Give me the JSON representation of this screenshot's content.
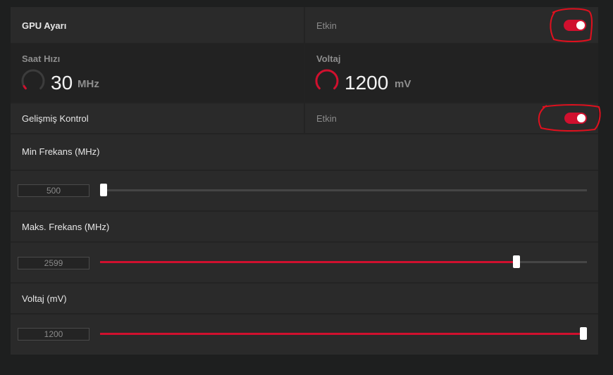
{
  "gpu_settings": {
    "title": "GPU Ayarı",
    "status": "Etkin",
    "enabled": true
  },
  "stats": {
    "clock": {
      "title": "Saat Hızı",
      "value": "30",
      "unit": "MHz"
    },
    "voltage": {
      "title": "Voltaj",
      "value": "1200",
      "unit": "mV"
    }
  },
  "advanced_control": {
    "title": "Gelişmiş Kontrol",
    "status": "Etkin",
    "enabled": true
  },
  "sliders": {
    "min_freq": {
      "label": "Min Frekans (MHz)",
      "value": "500",
      "fraction": 0.0
    },
    "max_freq": {
      "label": "Maks. Frekans (MHz)",
      "value": "2599",
      "fraction": 0.855
    },
    "voltage": {
      "label": "Voltaj (mV)",
      "value": "1200",
      "fraction": 1.0
    }
  },
  "colors": {
    "accent": "#d0102e",
    "annotation": "#e0101e"
  }
}
